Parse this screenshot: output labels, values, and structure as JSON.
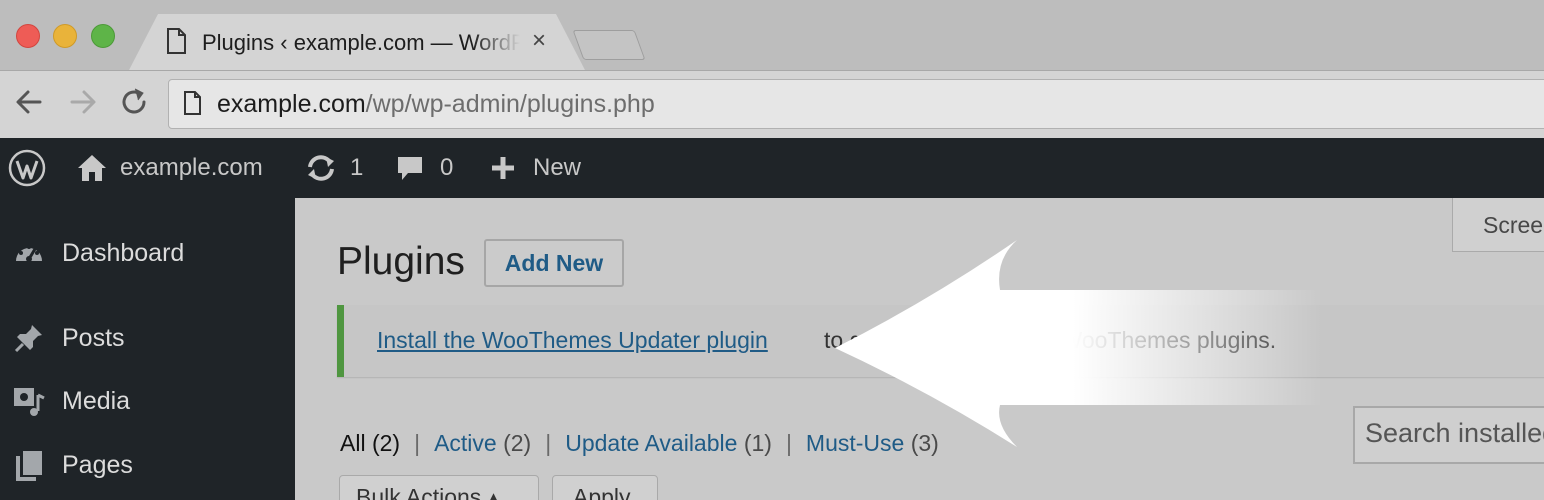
{
  "browser": {
    "tab_title": "Plugins ‹ example.com — WordPress",
    "tab_close": "×",
    "url_host": "example.com",
    "url_path": "/wp/wp-admin/plugins.php"
  },
  "adminbar": {
    "site_name": "example.com",
    "updates_count": "1",
    "comments_count": "0",
    "new_label": "New"
  },
  "sidebar": {
    "items": [
      {
        "label": "Dashboard",
        "icon": "dashboard-icon"
      },
      {
        "label": "Posts",
        "icon": "pushpin-icon"
      },
      {
        "label": "Media",
        "icon": "media-icon"
      },
      {
        "label": "Pages",
        "icon": "pages-icon"
      }
    ]
  },
  "main": {
    "screen_options": "Screen Options",
    "page_title": "Plugins",
    "add_new": "Add New",
    "notice_link": "Install the WooThemes Updater plugin",
    "notice_rest": "to get updates for your WooThemes plugins.",
    "filters": [
      {
        "label": "All",
        "count": "(2)"
      },
      {
        "label": "Active",
        "count": "(2)"
      },
      {
        "label": "Update Available",
        "count": "(1)"
      },
      {
        "label": "Must-Use",
        "count": "(3)"
      }
    ],
    "filter_separator": "|",
    "search_placeholder": "Search installed plugins...",
    "bulk_actions": "Bulk Actions",
    "apply": "Apply"
  },
  "colors": {
    "admin_bar": "#1f2428",
    "link": "#1f5b86",
    "notice_border": "#4f9640"
  }
}
